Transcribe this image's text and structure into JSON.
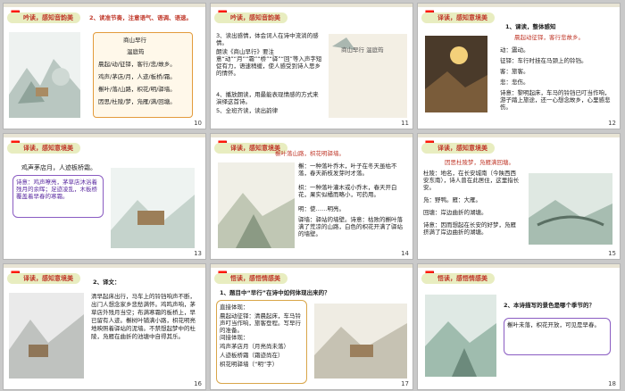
{
  "slides": [
    {
      "num": "10",
      "banner": "吟读，感知音韵美",
      "heading": "2、读准节奏，注意语气、语调、语速。",
      "poem_title": "商山早行",
      "author": "温庭筠",
      "lines": [
        "晨起/动/征铎，客行/悲/故乡。",
        "鸡声/茅店/月，人迹/板桥/霜。",
        "槲叶/落/山路，枳花/明/驿墙。",
        "因思/杜陵/梦，凫雁/满/回塘。"
      ]
    },
    {
      "num": "11",
      "banner": "吟读，感知音韵美",
      "items": [
        "3、读出感情，体会词人在诗中流淌的感情。",
        "朗读《商山早行》要注意“动”“月”“霜”“桥”“驿”“回”等入声字短促有力，语速稍缓，使人感受到诗人思乡的情怀。",
        "4、播放朗读，用最能表现情感的方式来演绎这首诗。",
        "5、全班齐读，读出韵律"
      ],
      "img_title": "商山早行 温庭筠"
    },
    {
      "num": "12",
      "banner": "译读，感知意境美",
      "heading": "1、课读，整体感知",
      "sub": "晨起动征铎，客行悲故乡。",
      "notes": [
        "动：震动。",
        "征铎：车行时挂在马颈上的铃铛。",
        "客：旅客。",
        "悲：悲伤。",
        "诗意：黎明起床，车马的铃铛已叮当作响，游子踏上旅途，还一心想念故乡，心里感悲伤。"
      ]
    },
    {
      "num": "13",
      "banner": "译读，感知意境美",
      "heading": "鸡声茅店月，人迹板桥霜。",
      "poem_text": "诗意：鸡声嘹亮，茅草店沐浴着残月的余晖；足迹凌乱，木板桥覆盖着早春的寒霜。"
    },
    {
      "num": "14",
      "banner": "译读，感知意境美",
      "heading": "槲叶落山路，枳花明驿墙。",
      "notes": [
        "槲：一种落叶乔木，叶子在冬天虽枯不落，春天新枝发芽时才落。",
        "枳：一种落叶灌木或小乔木，春天开白花，果实似橘而略小，可药用。",
        "明：使……明亮。",
        "驿墙：驿站的墙壁。诗意：枯败的槲叶落满了荒凉的山路，白色的枳花开满了驿站的墙壁。"
      ]
    },
    {
      "num": "15",
      "banner": "译读，感知意境美",
      "heading": "因思杜陵梦，凫雁满回塘。",
      "notes": [
        "杜陵：地名，在长安城南（今陕西西安东南），诗人曾在此居住，这里指长安。",
        "凫：野鸭。雁：大雁。",
        "回塘：岸边曲折的湖塘。",
        "诗意：因而想起在长安的好梦，凫雁挤满了岸边曲折的湖塘。"
      ]
    },
    {
      "num": "16",
      "banner": "译读，感知意境美",
      "heading": "2、译文：",
      "translation": "清早起床出行，马车上的铃铛响声不断，出门人想念家乡悲愁满怀。鸡鸣声响，茅草店外残月当空；布满寒霜的板桥上，早已留有人迹。槲树叶铺满小路，枳花明亮地映照着驿站的泥墙。不禁想起梦中的杜陵，凫雁在曲折的池塘中自得其乐。"
    },
    {
      "num": "17",
      "banner": "悟读，感悟情感美",
      "question": "1、题目中“早行”在诗中如何体现出来的？",
      "answer": [
        "直接体现：",
        "晨起动征铎：清晨起床，车马铃声叮当作响，旅客登程。写早行的准备。",
        "间接体现：",
        "鸡声茅店月（月亮尚未落）",
        "人迹板桥霜（霜迹尚在）",
        "枳花明驿墙（“明”字）"
      ]
    },
    {
      "num": "18",
      "banner": "悟读，感悟情感美",
      "question": "2、本诗描写的景色是哪个季节的？",
      "answer": "槲叶未落，枳花开放，可见是早春。"
    }
  ],
  "icons": {
    "logo": "seal-logo-icon"
  },
  "colors": {
    "banner_bg": "#e8edc0",
    "banner_text": "#c0392b",
    "orange_border": "#e39b3c",
    "purple_border": "#8a5cc2",
    "red_text": "#c0392b"
  }
}
